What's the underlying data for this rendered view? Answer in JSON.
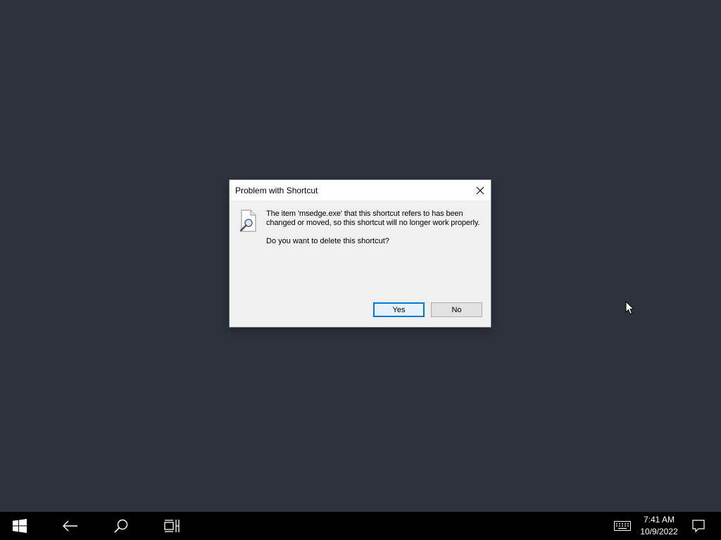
{
  "dialog": {
    "title": "Problem with Shortcut",
    "message_line1": "The item 'msedge.exe' that this shortcut refers to has been",
    "message_line2": "changed or moved, so this shortcut will no longer work properly.",
    "question": "Do you want to delete this shortcut?",
    "yes_label": "Yes",
    "no_label": "No",
    "icon": "broken-shortcut-icon"
  },
  "taskbar": {
    "time": "7:41 AM",
    "date": "10/9/2022",
    "icons": [
      "windows-start-icon",
      "back-arrow-icon",
      "search-icon",
      "task-view-icon",
      "touch-keyboard-icon",
      "notification-icon"
    ]
  },
  "colors": {
    "desktop": "#2e323d",
    "taskbar": "#000000",
    "dialog_body": "#f0f0f0",
    "accent": "#0078d7"
  }
}
